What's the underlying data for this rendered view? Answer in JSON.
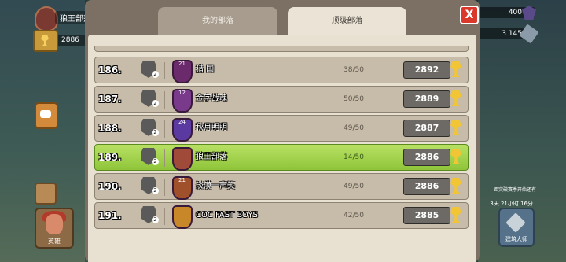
{
  "hud": {
    "clan_name": "狼王部落",
    "trophy_value": "2886",
    "gems": "400",
    "builder_resource": "3 145",
    "hero_label": "英雄",
    "right_note": "距突破赛季开始还有",
    "right_timer": "3天 21小时 16分",
    "builder_label": "建筑大师"
  },
  "tabs": [
    {
      "label": "我的部落"
    },
    {
      "label": "顶级部落"
    }
  ],
  "close_label": "X",
  "colors": {
    "highlight_row": "#8fc53a",
    "row": "#c7bba9",
    "close": "#d9382a"
  },
  "rows": [
    {
      "rank": "186.",
      "league_level": "2",
      "badge_level": "21",
      "name": "猎 国",
      "members": "38/50",
      "score": "2892",
      "badge_color": "#6b2a6b"
    },
    {
      "rank": "187.",
      "league_level": "2",
      "badge_level": "12",
      "name": "金字战魂",
      "members": "50/50",
      "score": "2889",
      "badge_color": "#7a3a8c"
    },
    {
      "rank": "188.",
      "league_level": "2",
      "badge_level": "24",
      "name": "秋月明明",
      "members": "49/50",
      "score": "2887",
      "badge_color": "#5a3aa0"
    },
    {
      "rank": "189.",
      "league_level": "2",
      "badge_level": "",
      "name": "狼王部落",
      "members": "14/50",
      "score": "2886",
      "badge_color": "#a04a3a",
      "me": true
    },
    {
      "rank": "190.",
      "league_level": "2",
      "badge_level": "21",
      "name": "淡漠一声笑",
      "members": "49/50",
      "score": "2886",
      "badge_color": "#a0502a"
    },
    {
      "rank": "191.",
      "league_level": "2",
      "badge_level": "",
      "name": "COC FAST BOYS",
      "members": "42/50",
      "score": "2885",
      "badge_color": "#c8882a"
    }
  ]
}
